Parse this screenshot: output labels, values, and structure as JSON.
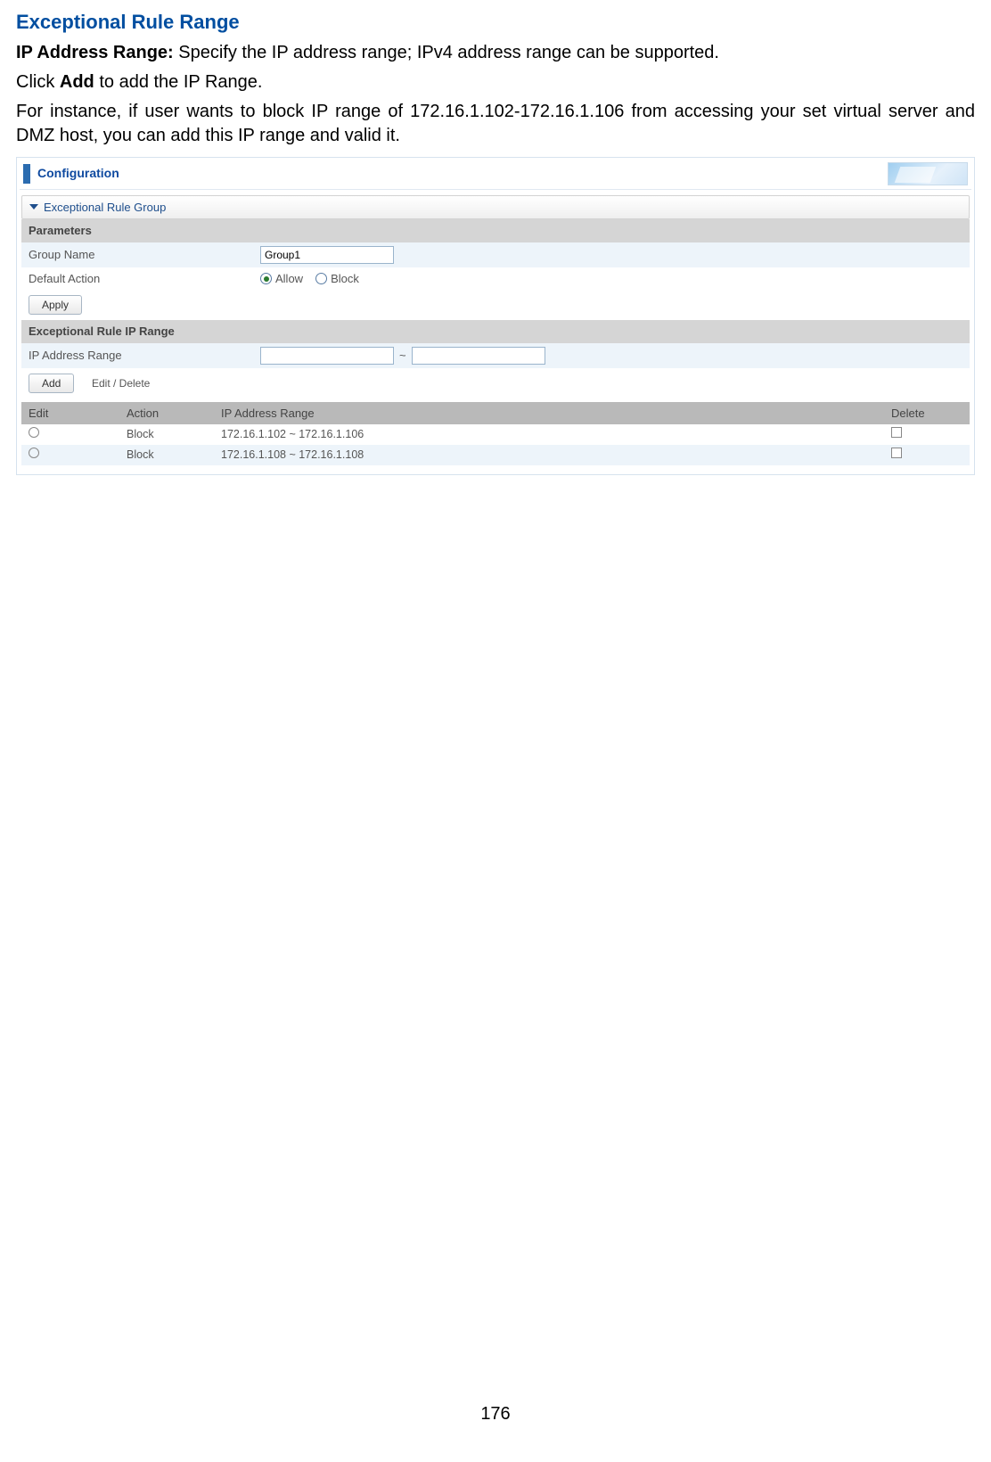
{
  "doc": {
    "heading": "Exceptional Rule Range",
    "p1_bold": "IP Address Range: ",
    "p1_rest": "Specify the IP address range; IPv4 address range can be supported.",
    "p2_a": "Click ",
    "p2_bold": "Add",
    "p2_b": " to add the IP Range.",
    "p3": "For instance, if user wants to block IP range of 172.16.1.102-172.16.1.106 from accessing your set virtual server and DMZ host, you can add this IP range and valid it.",
    "page_number": "176"
  },
  "panel": {
    "title": "Configuration",
    "section": "Exceptional Rule Group",
    "parameters_label": "Parameters",
    "group_name_label": "Group Name",
    "group_name_value": "Group1",
    "default_action_label": "Default Action",
    "radio_allow": "Allow",
    "radio_block": "Block",
    "apply_btn": "Apply",
    "iprange_section": "Exceptional Rule IP Range",
    "iprange_label": "IP Address Range",
    "ip_start": "",
    "ip_end": "",
    "add_btn": "Add",
    "editdelete_btn": "Edit / Delete",
    "table": {
      "h_edit": "Edit",
      "h_action": "Action",
      "h_ip": "IP Address Range",
      "h_delete": "Delete",
      "rows": [
        {
          "action": "Block",
          "ip": "172.16.1.102 ~ 172.16.1.106"
        },
        {
          "action": "Block",
          "ip": "172.16.1.108 ~ 172.16.1.108"
        }
      ]
    }
  }
}
